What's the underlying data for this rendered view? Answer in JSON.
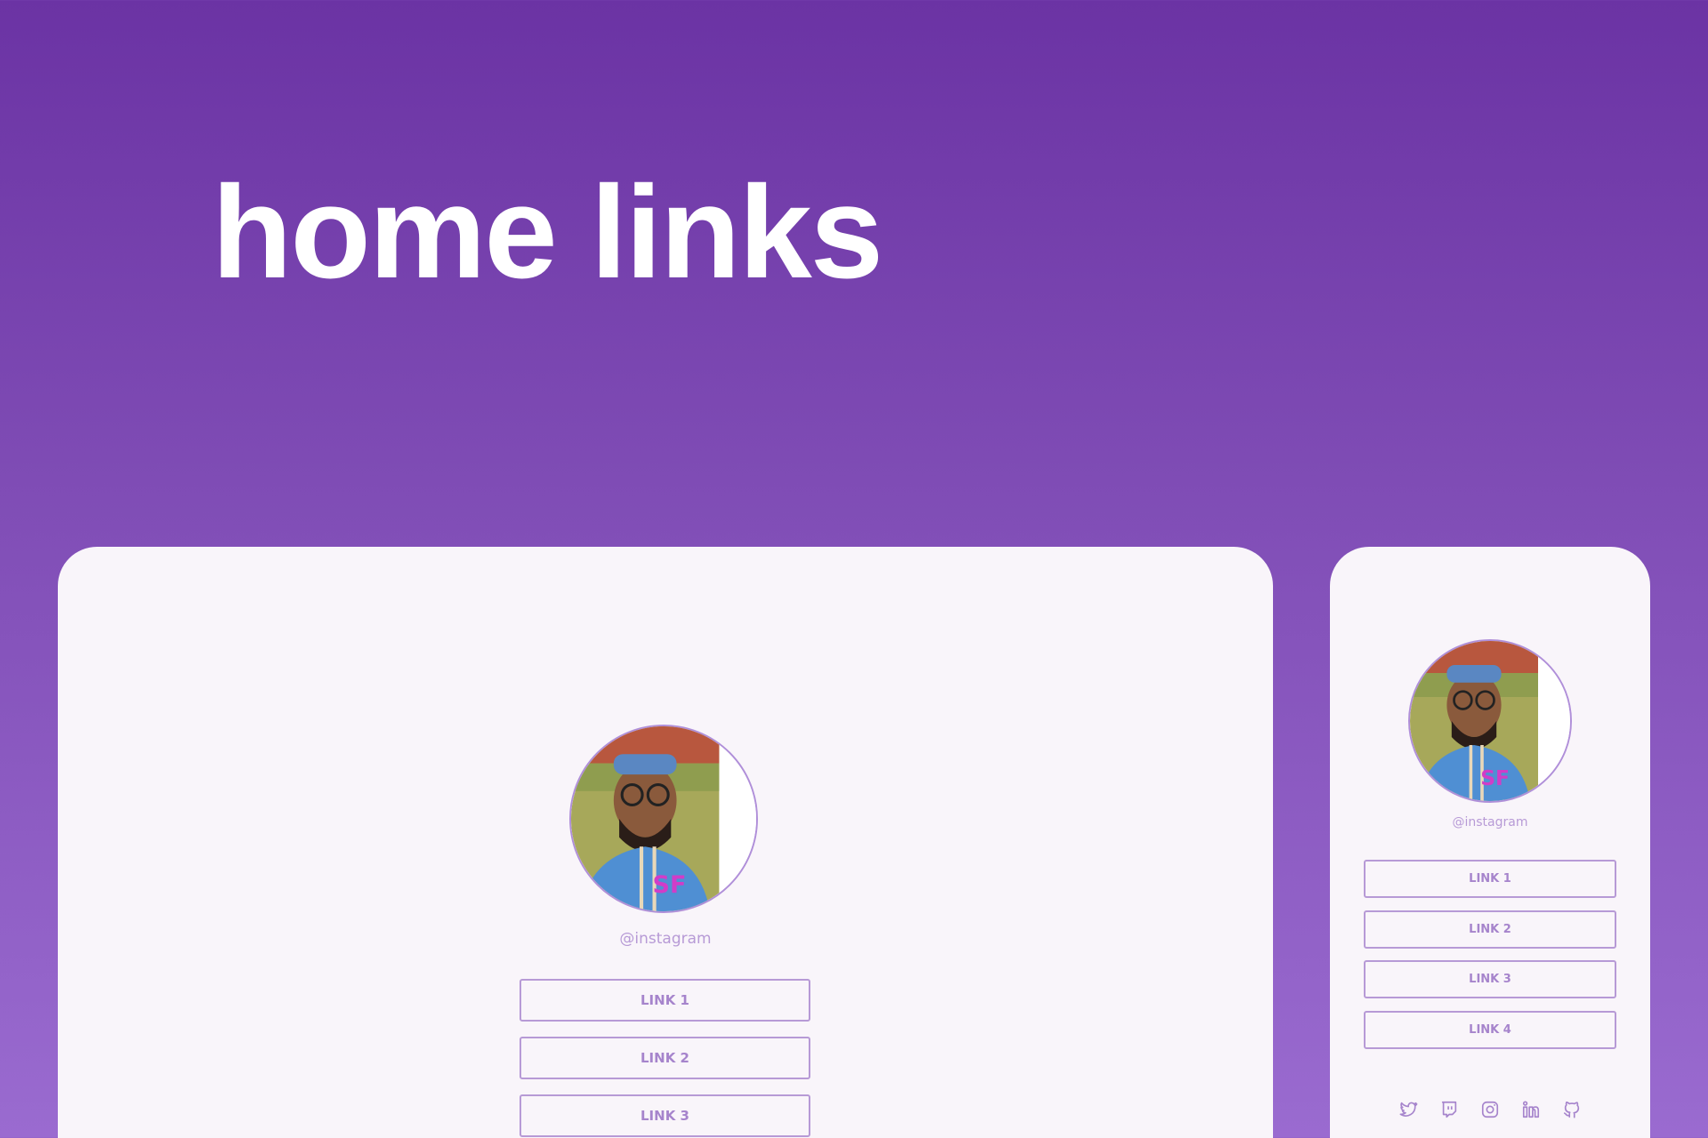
{
  "hero": {
    "title": "home links"
  },
  "desktop": {
    "handle": "@instagram",
    "links": [
      "LINK 1",
      "LINK 2",
      "LINK 3"
    ]
  },
  "mobile": {
    "handle": "@instagram",
    "links": [
      "LINK 1",
      "LINK 2",
      "LINK 3",
      "LINK 4"
    ],
    "socials": [
      "twitter-icon",
      "twitch-icon",
      "instagram-icon",
      "linkedin-icon",
      "github-icon"
    ]
  },
  "colors": {
    "gradient_top": "#6b33a4",
    "gradient_bottom": "#9a6bd0",
    "card": "#f9f5fa",
    "accent": "#b79ad6"
  }
}
